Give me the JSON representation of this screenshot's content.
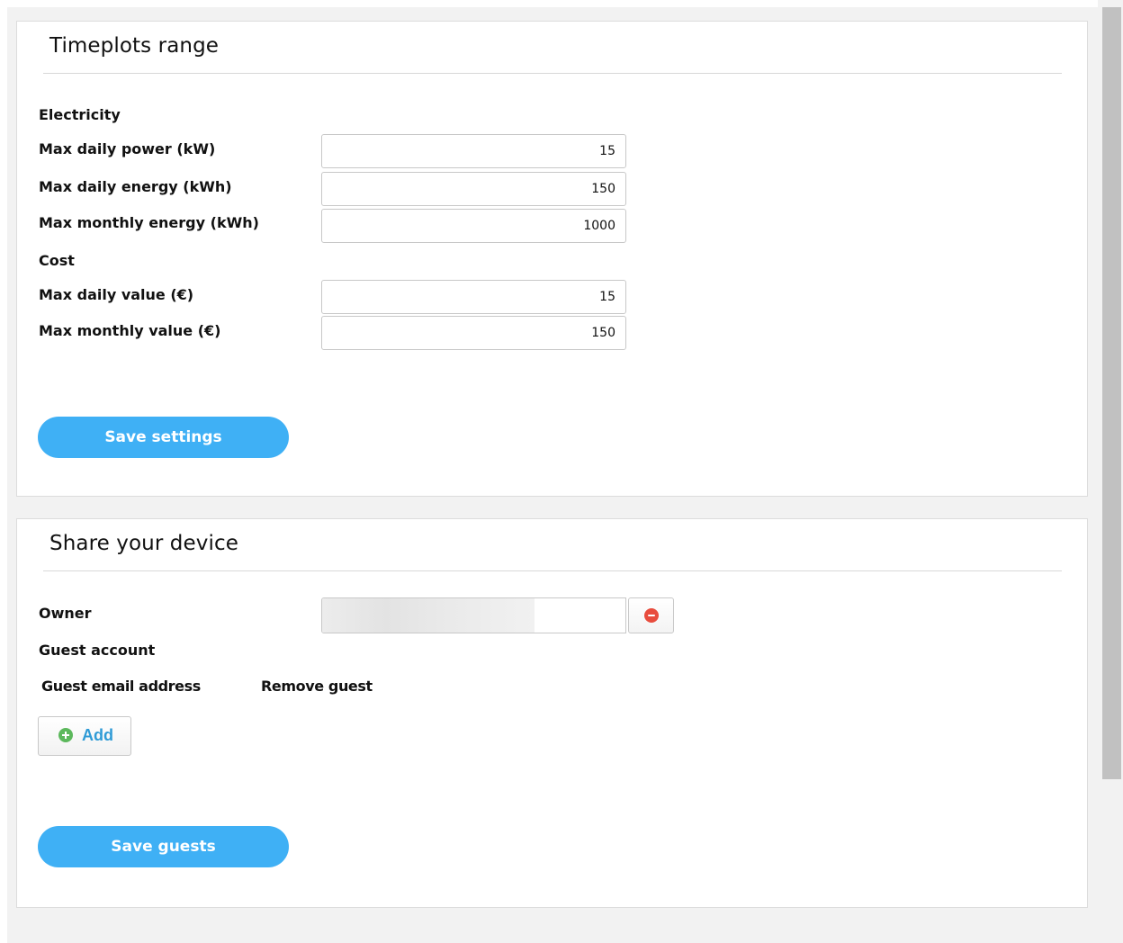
{
  "timeplots": {
    "title": "Timeplots range",
    "electricity_label": "Electricity",
    "max_daily_power_label": "Max daily power (kW)",
    "max_daily_power_value": "15",
    "max_daily_energy_label": "Max daily energy (kWh)",
    "max_daily_energy_value": "150",
    "max_monthly_energy_label": "Max monthly energy (kWh)",
    "max_monthly_energy_value": "1000",
    "cost_label": "Cost",
    "max_daily_value_label": "Max daily value (€)",
    "max_daily_value_value": "15",
    "max_monthly_value_label": "Max monthly value (€)",
    "max_monthly_value_value": "150",
    "save_label": "Save settings"
  },
  "share": {
    "title": "Share your device",
    "owner_label": "Owner",
    "owner_value": "",
    "guest_account_label": "Guest account",
    "guest_email_header": "Guest email address",
    "remove_guest_header": "Remove guest",
    "add_label": "Add",
    "save_label": "Save guests"
  },
  "icons": {
    "remove_owner": "minus-circle-icon",
    "add_guest": "plus-circle-icon"
  },
  "colors": {
    "primary_button": "#3fb0f5",
    "remove_icon": "#e84c3d",
    "add_icon": "#5cb85c",
    "link_text": "#2f9bd6",
    "page_background": "#f2f2f2"
  }
}
